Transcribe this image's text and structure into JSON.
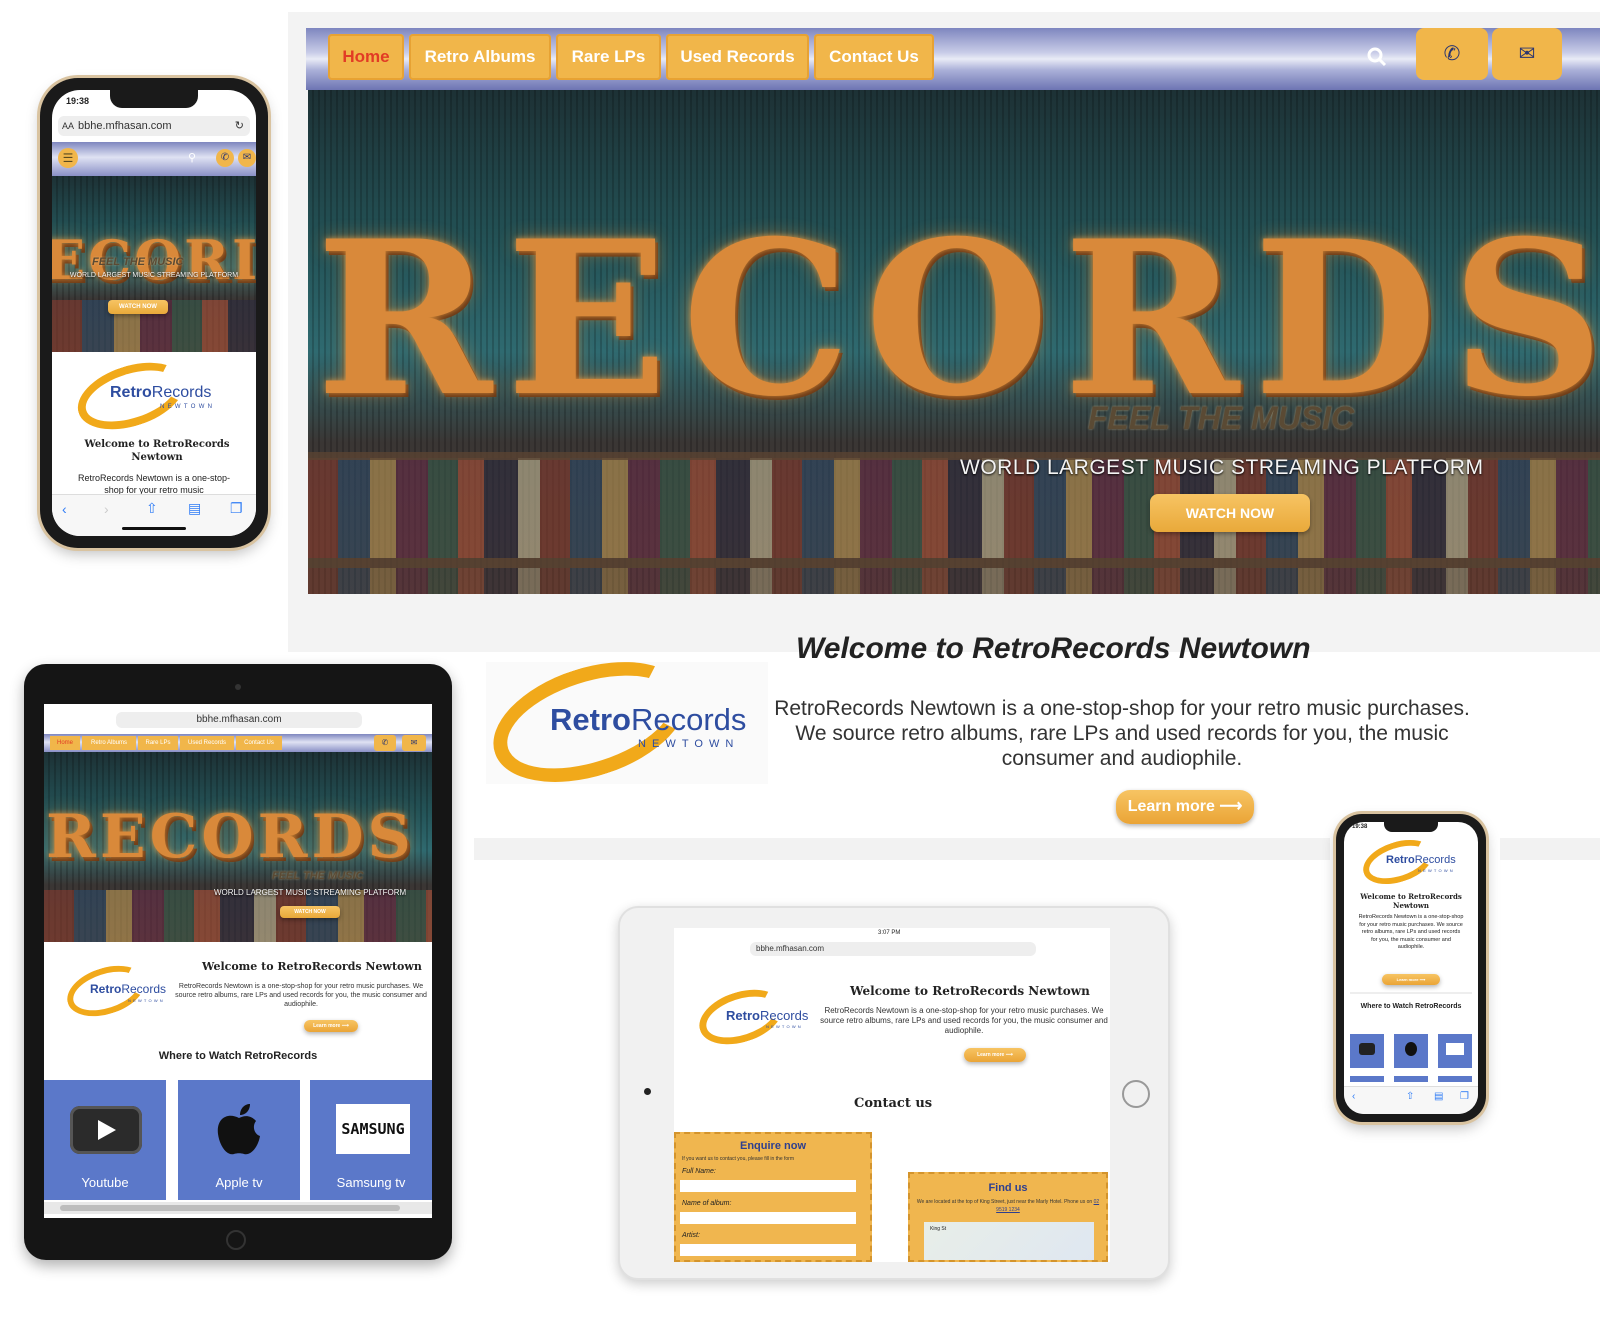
{
  "nav": {
    "items": [
      "Home",
      "Retro Albums",
      "Rare LPs",
      "Used Records",
      "Contact Us"
    ],
    "active": "Home"
  },
  "hero": {
    "sign_text": "RECORDS",
    "tagline": "FEEL THE MUSIC",
    "subtitle": "WORLD LARGEST MUSIC STREAMING PLATFORM",
    "cta": "WATCH NOW"
  },
  "welcome": {
    "title": "Welcome to RetroRecords Newtown",
    "body": "RetroRecords Newtown is a one-stop-shop for your retro music purchases. We source retro albums, rare LPs and used records for you, the music consumer and audiophile.",
    "cta": "Learn more ⟶"
  },
  "logo": {
    "brand_bold": "Retro",
    "brand_light": "Records",
    "sub": "NEWTOWN"
  },
  "phone_left": {
    "time": "19:38",
    "url": "bbhe.mfhasan.com",
    "aa": "AA",
    "hero_word": "ECORI",
    "welcome_title": "Welcome to RetroRecords Newtown",
    "welcome_snippet": "RetroRecords Newtown is a one-stop-shop for your retro music"
  },
  "tablet_left": {
    "url": "bbhe.mfhasan.com",
    "section_title": "Where to Watch RetroRecords",
    "cards": [
      "Youtube",
      "Apple tv",
      "Samsung tv"
    ],
    "samsung_logo": "SAMSUNG"
  },
  "tablet_center": {
    "url": "bbhe.mfhasan.com",
    "time": "3:07 PM",
    "contact_title": "Contact us",
    "enquire": {
      "title": "Enquire now",
      "hint": "If you want us to contact you, please fill in the form",
      "fields": [
        "Full Name:",
        "Name of album:",
        "Artist:"
      ]
    },
    "find": {
      "title": "Find us",
      "text": "We are located at the top of King Street, just near the Marly Hotel. Phone us on",
      "phone": "02 9519 1234",
      "map_label": "King St"
    }
  },
  "phone_right": {
    "time": "19:38",
    "section_title": "Where to Watch RetroRecords"
  }
}
